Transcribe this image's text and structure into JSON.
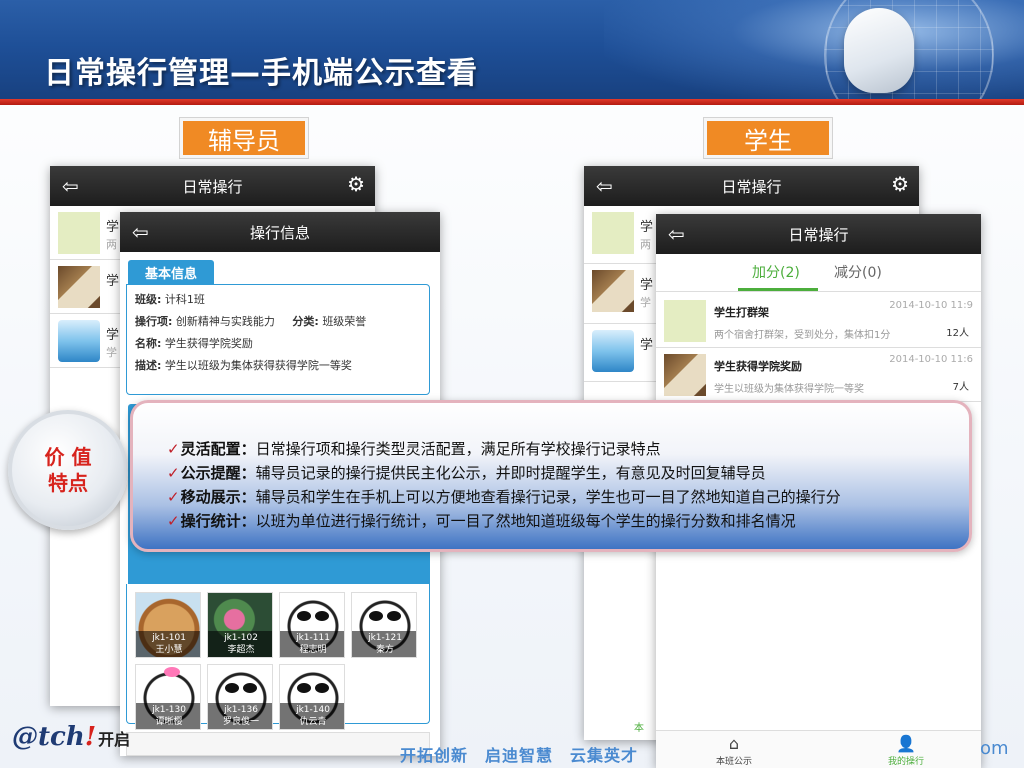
{
  "header": {
    "title": "日常操行管理—手机端公示查看"
  },
  "roles": {
    "teacher": "辅导员",
    "student": "学生"
  },
  "teacher_phone_back": {
    "title": "日常操行",
    "rows": [
      {
        "text": "学",
        "sub": "两"
      },
      {
        "text": "学",
        "sub": ""
      },
      {
        "text": "学",
        "sub": "学"
      }
    ]
  },
  "info_phone": {
    "title": "操行信息",
    "tab": "基本信息",
    "class_label": "班级:",
    "class_value": "计科1班",
    "item_label": "操行项:",
    "item_value": "创新精神与实践能力",
    "type_label": "分类:",
    "type_value": "班级荣誉",
    "name_label": "名称:",
    "name_value": "学生获得学院奖励",
    "desc_label": "描述:",
    "desc_value": "学生以班级为集体获得获得学院一等奖",
    "students": [
      {
        "id": "jk1-101",
        "name": "王小慧",
        "face": "bear"
      },
      {
        "id": "jk1-102",
        "name": "李超杰",
        "face": "flower"
      },
      {
        "id": "jk1-111",
        "name": "程志明",
        "face": "panda"
      },
      {
        "id": "jk1-121",
        "name": "秦方",
        "face": "panda"
      },
      {
        "id": "jk1-130",
        "name": "谭晰樱",
        "face": "pink"
      },
      {
        "id": "jk1-136",
        "name": "罗良俊一",
        "face": "panda"
      },
      {
        "id": "jk1-140",
        "name": "仇云青",
        "face": "panda"
      }
    ]
  },
  "student_phone_back": {
    "title": "日常操行",
    "rows": [
      {
        "text": "学",
        "sub": "两"
      },
      {
        "text": "学",
        "sub": "学"
      },
      {
        "text": "学",
        "sub": ""
      }
    ],
    "bottom_label": "本"
  },
  "student_phone": {
    "title": "日常操行",
    "tab_add": "加分(2)",
    "tab_minus": "减分(0)",
    "records": [
      {
        "title": "学生打群架",
        "desc": "两个宿舍打群架，受到处分，集体扣1分",
        "date": "2014-10-10 11:9",
        "count": "12人"
      },
      {
        "title": "学生获得学院奖励",
        "desc": "学生以班级为集体获得学院一等奖",
        "date": "2014-10-10 11:6",
        "count": "7人"
      }
    ],
    "nav_notice": "本班公示",
    "nav_mine": "我的操行"
  },
  "value_badge": {
    "line1": "价 值",
    "line2": "特点"
  },
  "callout": [
    {
      "key": "灵活配置：",
      "text": "日常操行项和操行类型灵活配置，满足所有学校操行记录特点"
    },
    {
      "key": "公示提醒：",
      "text": "辅导员记录的操行提供民主化公示，并即时提醒学生，有意见及时回复辅导员"
    },
    {
      "key": "移动展示：",
      "text": "辅导员和学生在手机上可以方便地查看操行记录，学生也可一目了然地知道自己的操行分"
    },
    {
      "key": "操行统计：",
      "text": "以班为单位进行操行统计，可一目了然地知道班级每个学生的操行分数和排名情况"
    }
  ],
  "footer": {
    "logo_a": "@tch",
    "logo_b": "!",
    "logo_cn": "开启",
    "slogan": "开拓创新　启迪智慧　云集英才",
    "om": "om"
  }
}
